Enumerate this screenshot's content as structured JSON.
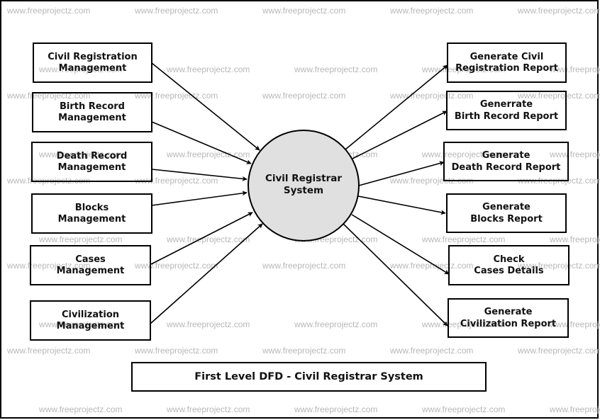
{
  "diagram": {
    "type": "data-flow-diagram",
    "title": "First Level DFD - Civil Registrar System",
    "watermark": "www.freeprojectz.com",
    "process": {
      "line1": "Civil Registrar",
      "line2": "System",
      "fill": "#e0e0e0"
    },
    "inputs": [
      {
        "line1": "Civil Registration",
        "line2": "Management"
      },
      {
        "line1": "Birth Record",
        "line2": "Management"
      },
      {
        "line1": "Death Record",
        "line2": "Management"
      },
      {
        "line1": "Blocks",
        "line2": "Management"
      },
      {
        "line1": "Cases",
        "line2": "Management"
      },
      {
        "line1": "Civilization",
        "line2": "Management"
      }
    ],
    "outputs": [
      {
        "line1": "Generate Civil",
        "line2": "Registration Report"
      },
      {
        "line1": "Generrate",
        "line2": "Birth Record Report"
      },
      {
        "line1": "Generate",
        "line2": "Death Record Report"
      },
      {
        "line1": "Generate",
        "line2": "Blocks Report"
      },
      {
        "line1": "Check",
        "line2": "Cases Details"
      },
      {
        "line1": "Generate",
        "line2": "Civilization Report"
      }
    ],
    "edges": [
      {
        "from": "Civil Registration Management",
        "to": "Civil Registrar System"
      },
      {
        "from": "Birth Record Management",
        "to": "Civil Registrar System"
      },
      {
        "from": "Death Record Management",
        "to": "Civil Registrar System"
      },
      {
        "from": "Blocks Management",
        "to": "Civil Registrar System"
      },
      {
        "from": "Cases Management",
        "to": "Civil Registrar System"
      },
      {
        "from": "Civilization Management",
        "to": "Civil Registrar System"
      },
      {
        "from": "Civil Registrar System",
        "to": "Generate Civil Registration Report"
      },
      {
        "from": "Civil Registrar System",
        "to": "Generrate Birth Record Report"
      },
      {
        "from": "Civil Registrar System",
        "to": "Generate Death Record Report"
      },
      {
        "from": "Civil Registrar System",
        "to": "Generate Blocks Report"
      },
      {
        "from": "Civil Registrar System",
        "to": "Check Cases Details"
      },
      {
        "from": "Civil Registrar System",
        "to": "Generate Civilization Report"
      }
    ]
  }
}
